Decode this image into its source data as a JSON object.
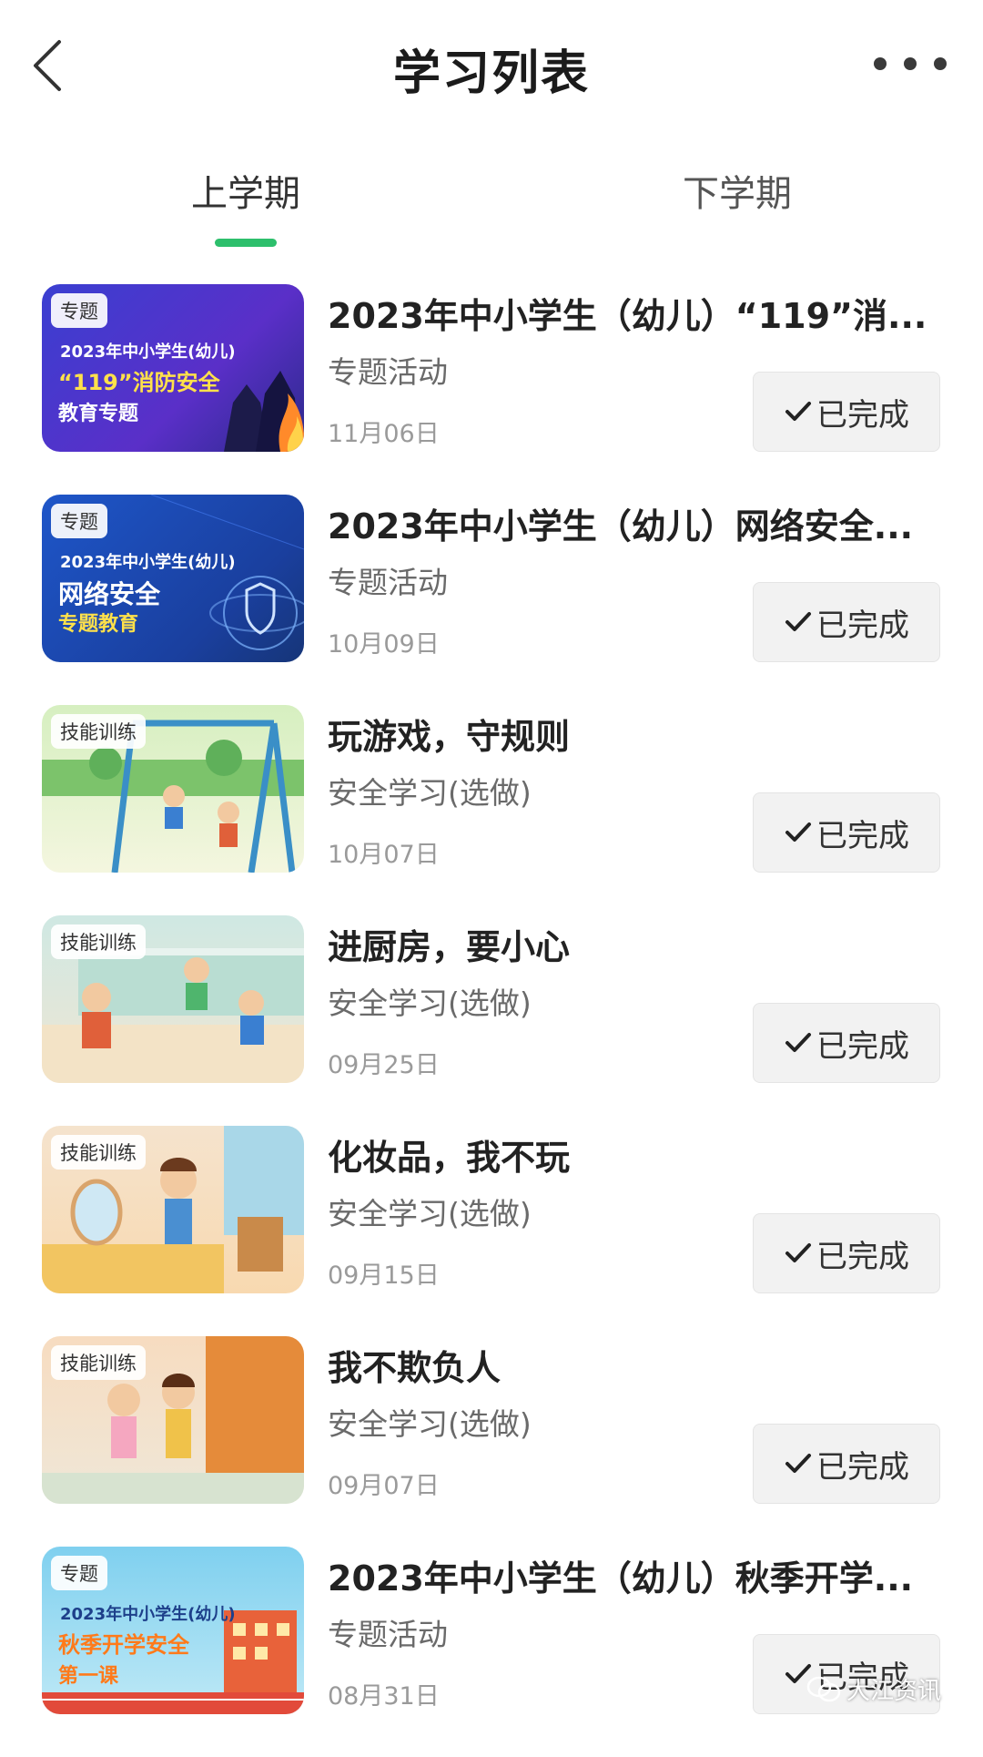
{
  "header": {
    "title": "学习列表",
    "back_icon": "chevron-left-icon",
    "more_icon": "more-horizontal-icon"
  },
  "tabs": [
    {
      "label": "上学期",
      "active": true
    },
    {
      "label": "下学期",
      "active": false
    }
  ],
  "accent_color": "#2dbf6c",
  "items": [
    {
      "badge": "专题",
      "thumb": {
        "line1": "2023年中小学生(幼儿)",
        "line2": "“119”消防安全",
        "line3": "教育专题",
        "bg": "#3a3fd1"
      },
      "title": "2023年中小学生（幼儿）“119”消...",
      "subtitle": "专题活动",
      "date": "11月06日",
      "status": "已完成"
    },
    {
      "badge": "专题",
      "thumb": {
        "line1": "2023年中小学生(幼儿)",
        "line2": "网络安全",
        "line3": "专题教育",
        "bg": "#1f4fb8"
      },
      "title": "2023年中小学生（幼儿）网络安全...",
      "subtitle": "专题活动",
      "date": "10月09日",
      "status": "已完成"
    },
    {
      "badge": "技能训练",
      "thumb": {
        "line1": "",
        "line2": "",
        "line3": "",
        "bg": "#c8e7b0"
      },
      "title": "玩游戏，守规则",
      "subtitle": "安全学习(选做)",
      "date": "10月07日",
      "status": "已完成"
    },
    {
      "badge": "技能训练",
      "thumb": {
        "line1": "",
        "line2": "",
        "line3": "",
        "bg": "#cfe8e3"
      },
      "title": "进厨房，要小心",
      "subtitle": "安全学习(选做)",
      "date": "09月25日",
      "status": "已完成"
    },
    {
      "badge": "技能训练",
      "thumb": {
        "line1": "",
        "line2": "",
        "line3": "",
        "bg": "#f3dcc0"
      },
      "title": "化妆品，我不玩",
      "subtitle": "安全学习(选做)",
      "date": "09月15日",
      "status": "已完成"
    },
    {
      "badge": "技能训练",
      "thumb": {
        "line1": "",
        "line2": "",
        "line3": "",
        "bg": "#f1cfa8"
      },
      "title": "我不欺负人",
      "subtitle": "安全学习(选做)",
      "date": "09月07日",
      "status": "已完成"
    },
    {
      "badge": "专题",
      "thumb": {
        "line1": "2023年中小学生(幼儿)",
        "line2": "秋季开学安全",
        "line3": "第一课",
        "bg": "#7fd0ef"
      },
      "title": "2023年中小学生（幼儿）秋季开学...",
      "subtitle": "专题活动",
      "date": "08月31日",
      "status": "已完成"
    }
  ],
  "watermark": {
    "text": "大江资讯",
    "icon": "wechat-icon"
  }
}
